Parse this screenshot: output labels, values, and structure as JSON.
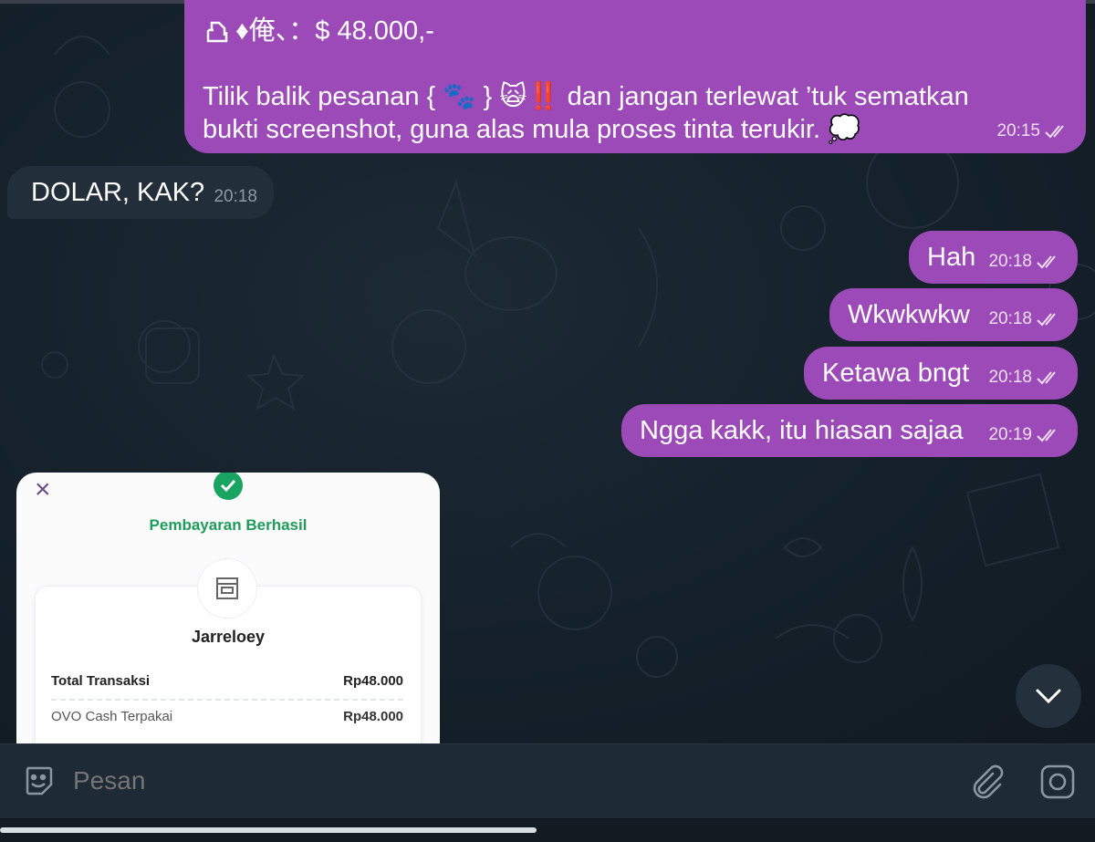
{
  "messages": [
    {
      "direction": "outgoing",
      "line1_text": "♦俺、：$ 48.000,-",
      "body_part1": "Tilik balik pesanan {",
      "body_emoji1": "🐾",
      "body_part2": "}",
      "body_emoji2": "🙀‼️",
      "body_part3": "dan jangan terlewat ’tuk sematkan",
      "body_line2": "bukti screenshot, guna alas mula proses tinta terukir.",
      "body_emoji3": "💭",
      "time": "20:15"
    },
    {
      "direction": "incoming",
      "text": "DOLAR, KAK?",
      "time": "20:18"
    },
    {
      "direction": "outgoing",
      "text": "Hah",
      "time": "20:18"
    },
    {
      "direction": "outgoing",
      "text": "Wkwkwkw",
      "time": "20:18"
    },
    {
      "direction": "outgoing",
      "text": "Ketawa bngt",
      "time": "20:18"
    },
    {
      "direction": "outgoing",
      "text": "Ngga kakk, itu hiasan sajaa",
      "time": "20:19"
    }
  ],
  "receipt": {
    "status_title": "Pembayaran Berhasil",
    "merchant": "Jarreloey",
    "total_label": "Total Transaksi",
    "total_value": "Rp48.000",
    "ovo_label": "OVO Cash Terpakai",
    "ovo_value": "Rp48.000",
    "close_glyph": "×"
  },
  "composer": {
    "placeholder": "Pesan"
  },
  "colors": {
    "outgoing_bubble": "#9b4ab8",
    "incoming_bubble": "#222e39",
    "background": "#131d25",
    "success_green": "#1aa462"
  },
  "icons": [
    "sticker-emoji-icon",
    "attach-paperclip-icon",
    "camera-icon",
    "chevron-down-icon",
    "double-check-icon",
    "close-icon",
    "check-icon",
    "store-icon",
    "share-icon"
  ]
}
